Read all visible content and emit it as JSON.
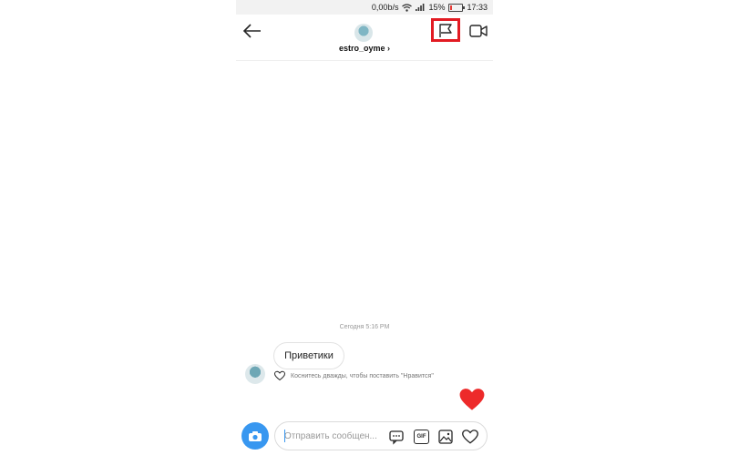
{
  "status_bar": {
    "network_speed": "0,00b/s",
    "battery_percent": "15%",
    "battery_level": 0.15,
    "time": "17:33"
  },
  "header": {
    "username": "estro_oyme",
    "username_chevron": "›"
  },
  "conversation": {
    "timestamp": "Сегодня 5:16 PM",
    "messages": [
      {
        "text": "Приветики"
      }
    ],
    "like_hint": "Коснитесь дважды, чтобы поставить \"Нравится\""
  },
  "composer": {
    "placeholder": "Отправить сообщен...",
    "gif_label": "GIF"
  },
  "colors": {
    "accent_blue": "#3897f0",
    "heart_red": "#ed2a2a",
    "highlight_red": "#e21b23"
  },
  "icons": [
    "back-arrow-icon",
    "flag-icon",
    "video-camera-icon",
    "heart-outline-icon",
    "heart-filled-icon",
    "camera-icon",
    "chat-bubble-icon",
    "gif-icon",
    "image-icon"
  ]
}
